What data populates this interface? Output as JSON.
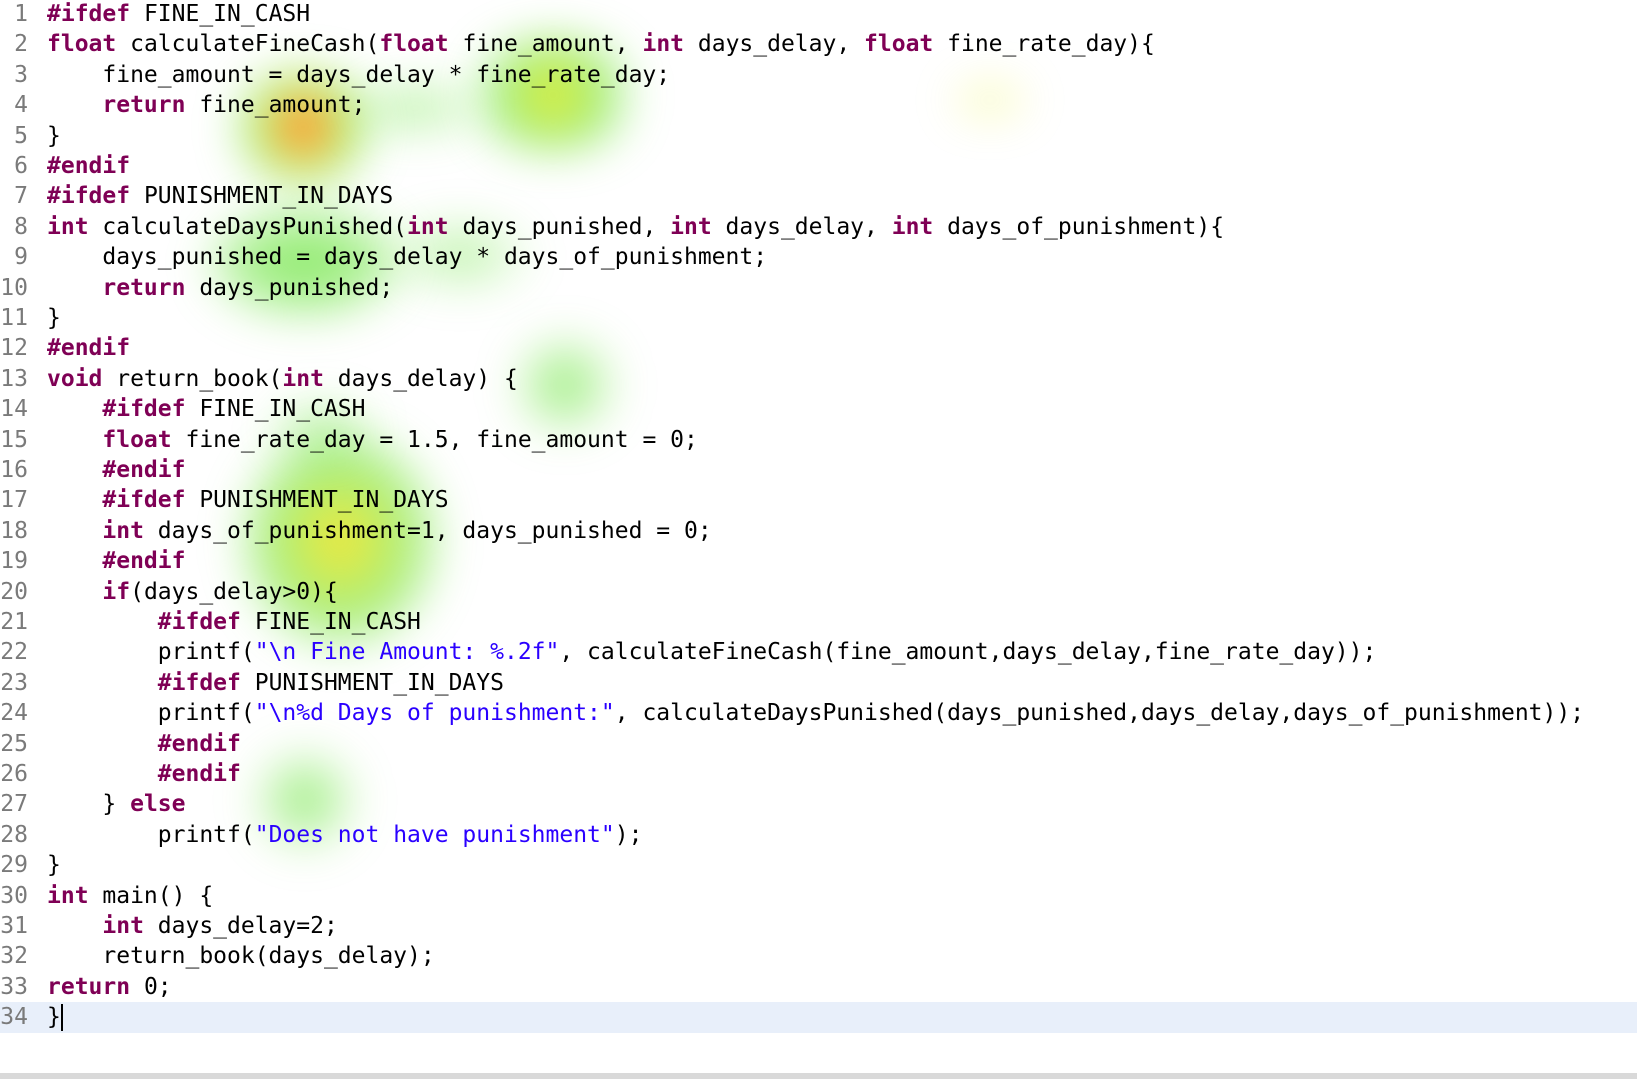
{
  "editor": {
    "language": "C",
    "current_line": 34,
    "colors": {
      "keyword": "#7f0055",
      "string": "#2a00ff",
      "line_number": "#7a7a7a",
      "current_line_bg": "#e6edfa"
    },
    "lines": [
      {
        "n": "1",
        "tokens": [
          {
            "t": "#ifdef",
            "k": "pp"
          },
          {
            "t": " FINE_IN_CASH"
          }
        ]
      },
      {
        "n": "2",
        "tokens": [
          {
            "t": "float",
            "k": "kw"
          },
          {
            "t": " calculateFineCash("
          },
          {
            "t": "float",
            "k": "kw"
          },
          {
            "t": " fine_amount, "
          },
          {
            "t": "int",
            "k": "kw"
          },
          {
            "t": " days_delay, "
          },
          {
            "t": "float",
            "k": "kw"
          },
          {
            "t": " fine_rate_day){"
          }
        ]
      },
      {
        "n": "3",
        "tokens": [
          {
            "t": "    fine_amount = days_delay * fine_rate_day;"
          }
        ]
      },
      {
        "n": "4",
        "tokens": [
          {
            "t": "    "
          },
          {
            "t": "return",
            "k": "kw"
          },
          {
            "t": " fine_amount;"
          }
        ]
      },
      {
        "n": "5",
        "tokens": [
          {
            "t": "}"
          }
        ]
      },
      {
        "n": "6",
        "tokens": [
          {
            "t": "#endif",
            "k": "pp"
          }
        ]
      },
      {
        "n": "7",
        "tokens": [
          {
            "t": "#ifdef",
            "k": "pp"
          },
          {
            "t": " PUNISHMENT_IN_DAYS"
          }
        ]
      },
      {
        "n": "8",
        "tokens": [
          {
            "t": "int",
            "k": "kw"
          },
          {
            "t": " calculateDaysPunished("
          },
          {
            "t": "int",
            "k": "kw"
          },
          {
            "t": " days_punished, "
          },
          {
            "t": "int",
            "k": "kw"
          },
          {
            "t": " days_delay, "
          },
          {
            "t": "int",
            "k": "kw"
          },
          {
            "t": " days_of_punishment){"
          }
        ]
      },
      {
        "n": "9",
        "tokens": [
          {
            "t": "    days_punished = days_delay * days_of_punishment;"
          }
        ]
      },
      {
        "n": "10",
        "tokens": [
          {
            "t": "    "
          },
          {
            "t": "return",
            "k": "kw"
          },
          {
            "t": " days_punished;"
          }
        ]
      },
      {
        "n": "11",
        "tokens": [
          {
            "t": "}"
          }
        ]
      },
      {
        "n": "12",
        "tokens": [
          {
            "t": "#endif",
            "k": "pp"
          }
        ]
      },
      {
        "n": "13",
        "tokens": [
          {
            "t": "void",
            "k": "kw"
          },
          {
            "t": " return_book("
          },
          {
            "t": "int",
            "k": "kw"
          },
          {
            "t": " days_delay) {"
          }
        ]
      },
      {
        "n": "14",
        "tokens": [
          {
            "t": "    "
          },
          {
            "t": "#ifdef",
            "k": "pp"
          },
          {
            "t": " FINE_IN_CASH"
          }
        ]
      },
      {
        "n": "15",
        "tokens": [
          {
            "t": "    "
          },
          {
            "t": "float",
            "k": "kw"
          },
          {
            "t": " fine_rate_day = 1.5, fine_amount = 0;"
          }
        ]
      },
      {
        "n": "16",
        "tokens": [
          {
            "t": "    "
          },
          {
            "t": "#endif",
            "k": "pp"
          }
        ]
      },
      {
        "n": "17",
        "tokens": [
          {
            "t": "    "
          },
          {
            "t": "#ifdef",
            "k": "pp"
          },
          {
            "t": " PUNISHMENT_IN_DAYS"
          }
        ]
      },
      {
        "n": "18",
        "tokens": [
          {
            "t": "    "
          },
          {
            "t": "int",
            "k": "kw"
          },
          {
            "t": " days_of_punishment=1, days_punished = 0;"
          }
        ]
      },
      {
        "n": "19",
        "tokens": [
          {
            "t": "    "
          },
          {
            "t": "#endif",
            "k": "pp"
          }
        ]
      },
      {
        "n": "20",
        "tokens": [
          {
            "t": "    "
          },
          {
            "t": "if",
            "k": "kw"
          },
          {
            "t": "(days_delay>0){"
          }
        ]
      },
      {
        "n": "21",
        "tokens": [
          {
            "t": "        "
          },
          {
            "t": "#ifdef",
            "k": "pp"
          },
          {
            "t": " FINE_IN_CASH"
          }
        ]
      },
      {
        "n": "22",
        "tokens": [
          {
            "t": "        printf("
          },
          {
            "t": "\"\\n Fine Amount: %.2f\"",
            "k": "str"
          },
          {
            "t": ", calculateFineCash(fine_amount,days_delay,fine_rate_day));"
          }
        ]
      },
      {
        "n": "23",
        "tokens": [
          {
            "t": "        "
          },
          {
            "t": "#ifdef",
            "k": "pp"
          },
          {
            "t": " PUNISHMENT_IN_DAYS"
          }
        ]
      },
      {
        "n": "24",
        "tokens": [
          {
            "t": "        printf("
          },
          {
            "t": "\"\\n%d Days of punishment:\"",
            "k": "str"
          },
          {
            "t": ", calculateDaysPunished(days_punished,days_delay,days_of_punishment));"
          }
        ]
      },
      {
        "n": "25",
        "tokens": [
          {
            "t": "        "
          },
          {
            "t": "#endif",
            "k": "pp"
          }
        ]
      },
      {
        "n": "26",
        "tokens": [
          {
            "t": "        "
          },
          {
            "t": "#endif",
            "k": "pp"
          }
        ]
      },
      {
        "n": "27",
        "tokens": [
          {
            "t": "    } "
          },
          {
            "t": "else",
            "k": "kw"
          }
        ]
      },
      {
        "n": "28",
        "tokens": [
          {
            "t": "        printf("
          },
          {
            "t": "\"Does not have punishment\"",
            "k": "str"
          },
          {
            "t": ");"
          }
        ]
      },
      {
        "n": "29",
        "tokens": [
          {
            "t": "}"
          }
        ]
      },
      {
        "n": "30",
        "tokens": [
          {
            "t": "int",
            "k": "kw"
          },
          {
            "t": " main() {"
          }
        ]
      },
      {
        "n": "31",
        "tokens": [
          {
            "t": "    "
          },
          {
            "t": "int",
            "k": "kw"
          },
          {
            "t": " days_delay=2;"
          }
        ]
      },
      {
        "n": "32",
        "tokens": [
          {
            "t": "    return_book(days_delay);"
          }
        ]
      },
      {
        "n": "33",
        "tokens": [
          {
            "t": "return",
            "k": "kw"
          },
          {
            "t": " 0;"
          }
        ]
      },
      {
        "n": "34",
        "tokens": [
          {
            "t": "}"
          }
        ]
      }
    ]
  }
}
